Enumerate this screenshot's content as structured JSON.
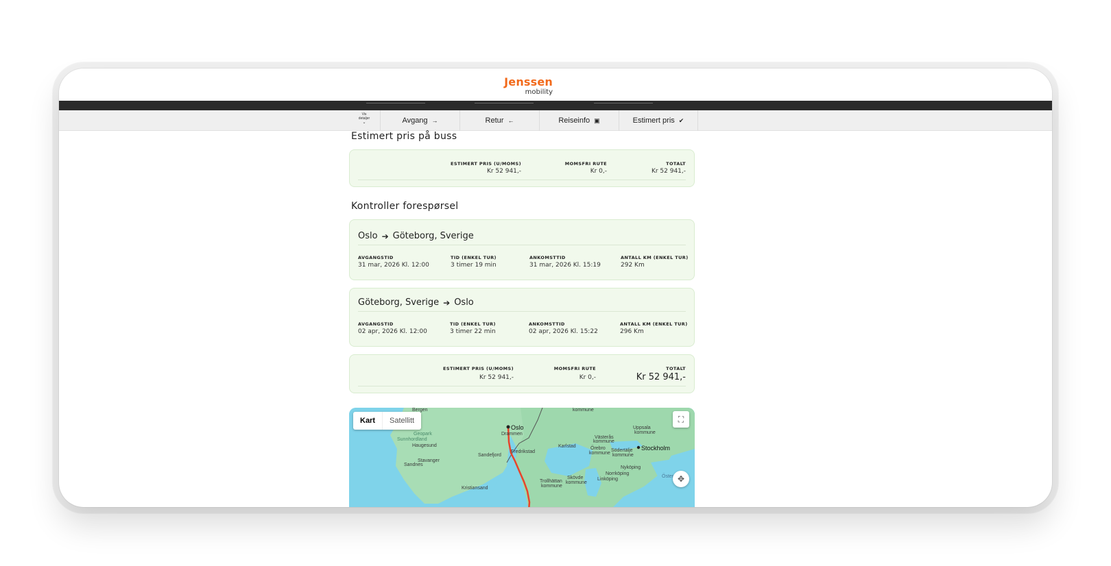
{
  "header": {
    "logo_line1": "Jenssen",
    "logo_line2": "mobility"
  },
  "nav": {
    "toggle_line1": "Vis",
    "toggle_line2": "detaljer",
    "toggle_icon": "chevron-down-icon",
    "items": [
      {
        "label": "Avgang",
        "icon": "→"
      },
      {
        "label": "Retur",
        "icon": "←"
      },
      {
        "label": "Reiseinfo",
        "icon": "▣"
      },
      {
        "label": "Estimert pris",
        "icon": "✔"
      }
    ]
  },
  "price_summary": {
    "title": "Estimert pris på buss",
    "est_label": "ESTIMERT PRIS (U/MOMS)",
    "est_value": "Kr 52 941,-",
    "vat_label": "MOMSFRI RUTE",
    "vat_value": "Kr 0,-",
    "total_label": "TOTALT",
    "total_value": "Kr 52 941,-"
  },
  "request": {
    "title": "Kontroller forespørsel",
    "legs": [
      {
        "from": "Oslo",
        "to": "Göteborg, Sverige",
        "dep_label": "AVGANGSTID",
        "dep_value": "31 mar, 2026 Kl. 12:00",
        "dur_label": "TID (ENKEL TUR)",
        "dur_value": "3 timer 19 min",
        "arr_label": "ANKOMSTTID",
        "arr_value": "31 mar, 2026 Kl. 15:19",
        "km_label": "ANTALL KM (ENKEL TUR)",
        "km_value": "292 Km"
      },
      {
        "from": "Göteborg, Sverige",
        "to": "Oslo",
        "dep_label": "AVGANGSTID",
        "dep_value": "02 apr, 2026 Kl. 12:00",
        "dur_label": "TID (ENKEL TUR)",
        "dur_value": "3 timer 22 min",
        "arr_label": "ANKOMSTTID",
        "arr_value": "02 apr, 2026 Kl. 15:22",
        "km_label": "ANTALL KM (ENKEL TUR)",
        "km_value": "296 Km"
      }
    ],
    "total": {
      "est_label": "ESTIMERT PRIS (U/MOMS)",
      "est_value": "Kr 52 941,-",
      "vat_label": "MOMSFRI RUTE",
      "vat_value": "Kr 0,-",
      "total_label": "TOTALT",
      "total_value": "Kr 52 941,-"
    }
  },
  "map": {
    "tab_map": "Kart",
    "tab_satellite": "Satellitt",
    "fullscreen_icon": "fullscreen-icon",
    "camera_icon": "camera-control-icon",
    "route_color": "#e8442b",
    "labels": {
      "bergen": "Bergen",
      "kommune_top": "kommune",
      "oslo": "Oslo",
      "drammen": "Drammen",
      "uppsala": "Uppsala",
      "uppsala_k": "kommune",
      "geopark1": "Geopark",
      "geopark2": "Sunnhordland",
      "haugesund": "Haugesund",
      "karlstad": "Karlstad",
      "vasteras": "Västerås",
      "vasteras_k": "kommune",
      "stockholm": "Stockholm",
      "fredrikstad": "Fredrikstad",
      "sandefjord": "Sandefjord",
      "orebro": "Örebro",
      "orebro_k": "kommune",
      "sodertalje": "Södertälje",
      "sodertalje_k": "kommune",
      "stavanger": "Stavanger",
      "sandnes": "Sandnes",
      "nykoping": "Nyköping",
      "norrkoping": "Norrköping",
      "trollhattan": "Trollhättan",
      "trollhattan_k": "kommune",
      "skovde": "Skövde",
      "skovde_k": "kommune",
      "linkoping": "Linköping",
      "oster": "Öster",
      "kristiansand": "Kristiansand"
    }
  }
}
